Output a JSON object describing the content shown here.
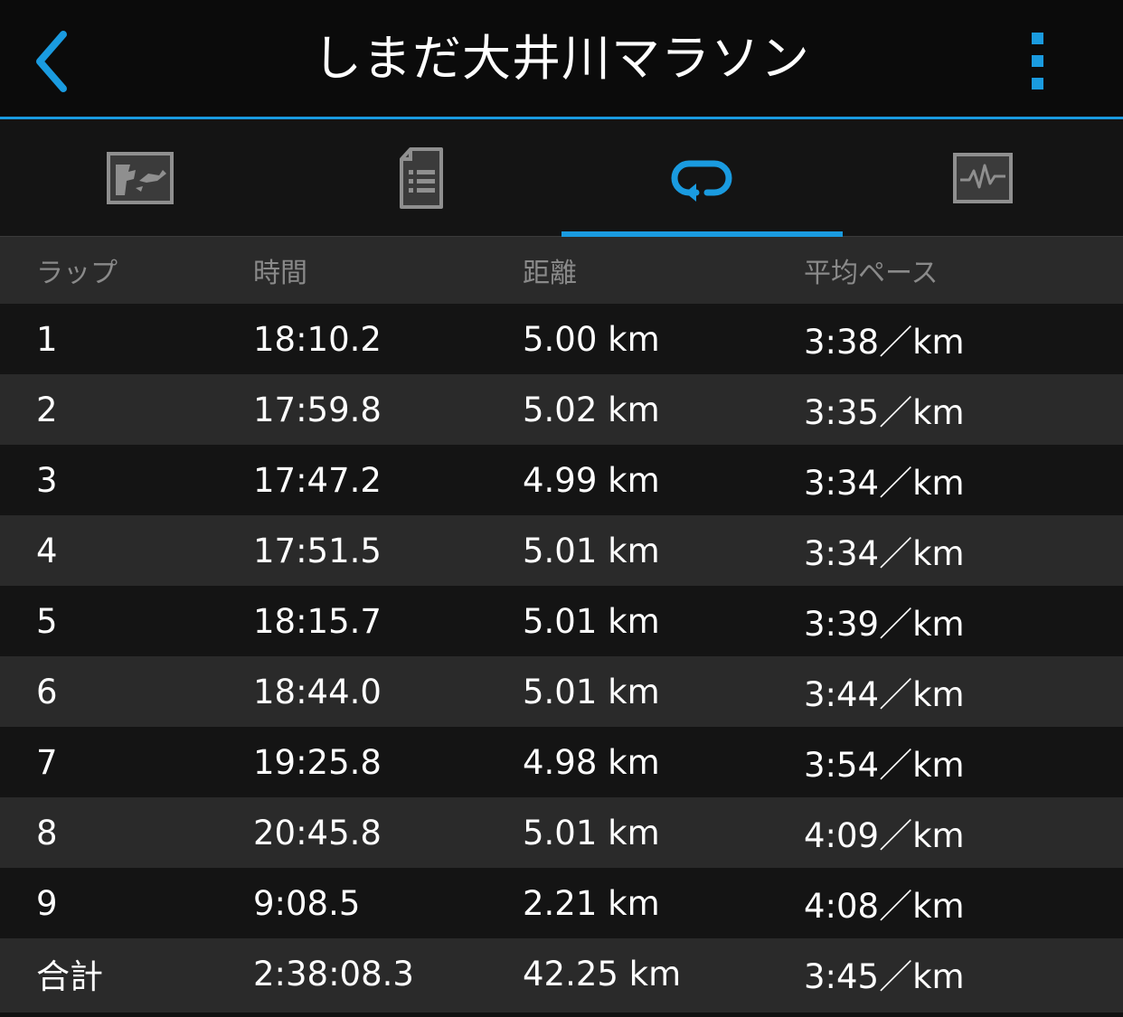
{
  "header": {
    "title": "しまだ大井川マラソン",
    "back_icon": "chevron-left-icon",
    "more_icon": "more-vertical-icon"
  },
  "tabs": [
    {
      "icon": "map-icon",
      "active": false
    },
    {
      "icon": "details-list-icon",
      "active": false
    },
    {
      "icon": "laps-loop-icon",
      "active": true
    },
    {
      "icon": "chart-icon",
      "active": false
    }
  ],
  "colors": {
    "accent": "#1a9be0",
    "row_dark": "#141414",
    "row_light": "#2a2a2a",
    "header_text": "#8a8a8a"
  },
  "table": {
    "columns": [
      "ラップ",
      "時間",
      "距離",
      "平均ペース"
    ],
    "rows": [
      {
        "lap": "1",
        "time": "18:10.2",
        "distance": "5.00 km",
        "pace": "3:38／km"
      },
      {
        "lap": "2",
        "time": "17:59.8",
        "distance": "5.02 km",
        "pace": "3:35／km"
      },
      {
        "lap": "3",
        "time": "17:47.2",
        "distance": "4.99 km",
        "pace": "3:34／km"
      },
      {
        "lap": "4",
        "time": "17:51.5",
        "distance": "5.01 km",
        "pace": "3:34／km"
      },
      {
        "lap": "5",
        "time": "18:15.7",
        "distance": "5.01 km",
        "pace": "3:39／km"
      },
      {
        "lap": "6",
        "time": "18:44.0",
        "distance": "5.01 km",
        "pace": "3:44／km"
      },
      {
        "lap": "7",
        "time": "19:25.8",
        "distance": "4.98 km",
        "pace": "3:54／km"
      },
      {
        "lap": "8",
        "time": "20:45.8",
        "distance": "5.01 km",
        "pace": "4:09／km"
      },
      {
        "lap": "9",
        "time": "9:08.5",
        "distance": "2.21 km",
        "pace": "4:08／km"
      }
    ],
    "total": {
      "lap": "合計",
      "time": "2:38:08.3",
      "distance": "42.25 km",
      "pace": "3:45／km"
    }
  }
}
